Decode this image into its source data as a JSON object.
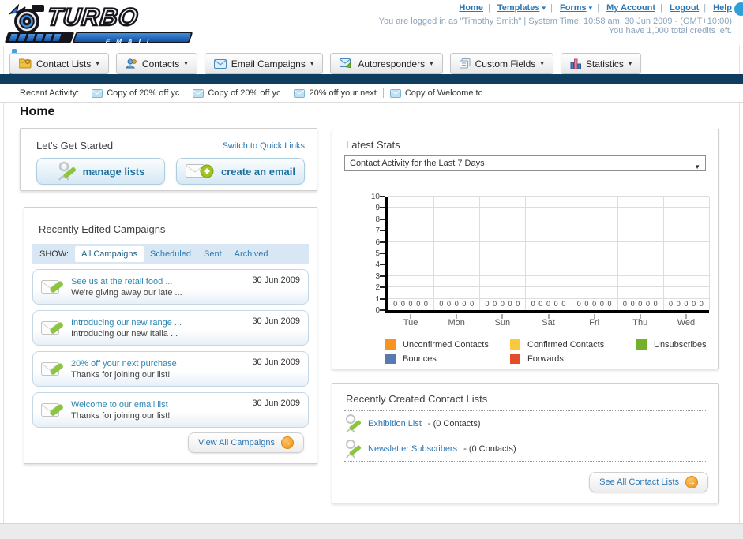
{
  "header": {
    "links": [
      {
        "label": "Home",
        "dropdown": false
      },
      {
        "label": "Templates",
        "dropdown": true
      },
      {
        "label": "Forms",
        "dropdown": true
      },
      {
        "label": "My Account",
        "dropdown": false
      },
      {
        "label": "Logout",
        "dropdown": false
      },
      {
        "label": "Help",
        "dropdown": false
      }
    ],
    "login_line": "You are logged in as \"Timothy Smith\" | System Time: 10:58 am, 30 Jun 2009 - (GMT+10:00)",
    "credits_line": "You have 1,000 total credits left.",
    "logo_title": "TURBO",
    "logo_subtitle": "EMAIL"
  },
  "nav": {
    "tabs": [
      {
        "label": "Contact Lists",
        "icon": "folder-icon"
      },
      {
        "label": "Contacts",
        "icon": "people-icon"
      },
      {
        "label": "Email Campaigns",
        "icon": "envelope-icon"
      },
      {
        "label": "Autoresponders",
        "icon": "envelope-arrow-icon"
      },
      {
        "label": "Custom Fields",
        "icon": "pages-icon"
      },
      {
        "label": "Statistics",
        "icon": "bar-chart-icon"
      }
    ]
  },
  "recent_activity": {
    "label": "Recent Activity:",
    "items": [
      {
        "text": "Copy of 20% off yc"
      },
      {
        "text": "Copy of 20% off yc"
      },
      {
        "text": "20% off your next"
      },
      {
        "text": "Copy of Welcome tc"
      }
    ]
  },
  "page_title": "Home",
  "get_started": {
    "title": "Let's Get Started",
    "switch_link": "Switch to Quick Links",
    "manage_lists_label": "manage lists",
    "create_email_label": "create an email"
  },
  "campaigns": {
    "title": "Recently Edited Campaigns",
    "show_label": "SHOW:",
    "tabs": [
      "All Campaigns",
      "Scheduled",
      "Sent",
      "Archived"
    ],
    "active_tab": "All Campaigns",
    "items": [
      {
        "title": "See us at the retail food ...",
        "subtitle": "We're giving away our late ...",
        "date": "30 Jun 2009"
      },
      {
        "title": "Introducing our new range ...",
        "subtitle": "Introducing our new Italia ...",
        "date": "30 Jun 2009"
      },
      {
        "title": "20% off your next purchase",
        "subtitle": "Thanks for joining our list!",
        "date": "30 Jun 2009"
      },
      {
        "title": "Welcome to our email list",
        "subtitle": "Thanks for joining our list!",
        "date": "30 Jun 2009"
      }
    ],
    "view_all_label": "View All Campaigns"
  },
  "latest_stats": {
    "title": "Latest Stats",
    "dropdown_value": "Contact Activity for the Last 7 Days"
  },
  "chart_data": {
    "type": "bar",
    "title": "Contact Activity for the Last 7 Days",
    "categories": [
      "Tue",
      "Mon",
      "Sun",
      "Sat",
      "Fri",
      "Thu",
      "Wed"
    ],
    "series": [
      {
        "name": "Unconfirmed Contacts",
        "color": "#F79321",
        "values": [
          0,
          0,
          0,
          0,
          0,
          0,
          0
        ]
      },
      {
        "name": "Confirmed Contacts",
        "color": "#FCC93C",
        "values": [
          0,
          0,
          0,
          0,
          0,
          0,
          0
        ]
      },
      {
        "name": "Unsubscribes",
        "color": "#74B02C",
        "values": [
          0,
          0,
          0,
          0,
          0,
          0,
          0
        ]
      },
      {
        "name": "Bounces",
        "color": "#5A79B0",
        "values": [
          0,
          0,
          0,
          0,
          0,
          0,
          0
        ]
      },
      {
        "name": "Forwards",
        "color": "#E44D26",
        "values": [
          0,
          0,
          0,
          0,
          0,
          0,
          0
        ]
      }
    ],
    "xlabel": "",
    "ylabel": "",
    "ylim": [
      0,
      10
    ],
    "yticks": [
      0,
      1,
      2,
      3,
      4,
      5,
      6,
      7,
      8,
      9,
      10
    ],
    "grid": true,
    "legend_position": "bottom",
    "value_labels_shown": true
  },
  "contact_lists": {
    "title": "Recently Created Contact Lists",
    "items": [
      {
        "name": "Exhibition List",
        "detail": "- (0 Contacts)"
      },
      {
        "name": "Newsletter Subscribers",
        "detail": "- (0 Contacts)"
      }
    ],
    "see_all_label": "See All Contact Lists"
  },
  "ui": {
    "caret_down": "▾",
    "select_arrow": "▼",
    "arrow_right": "→"
  },
  "colors": {
    "navy_bar": "#0F3D5F",
    "link_blue": "#2D77B3",
    "button_orange": "#EF930E",
    "logo_blue": "#2F7FD0"
  }
}
